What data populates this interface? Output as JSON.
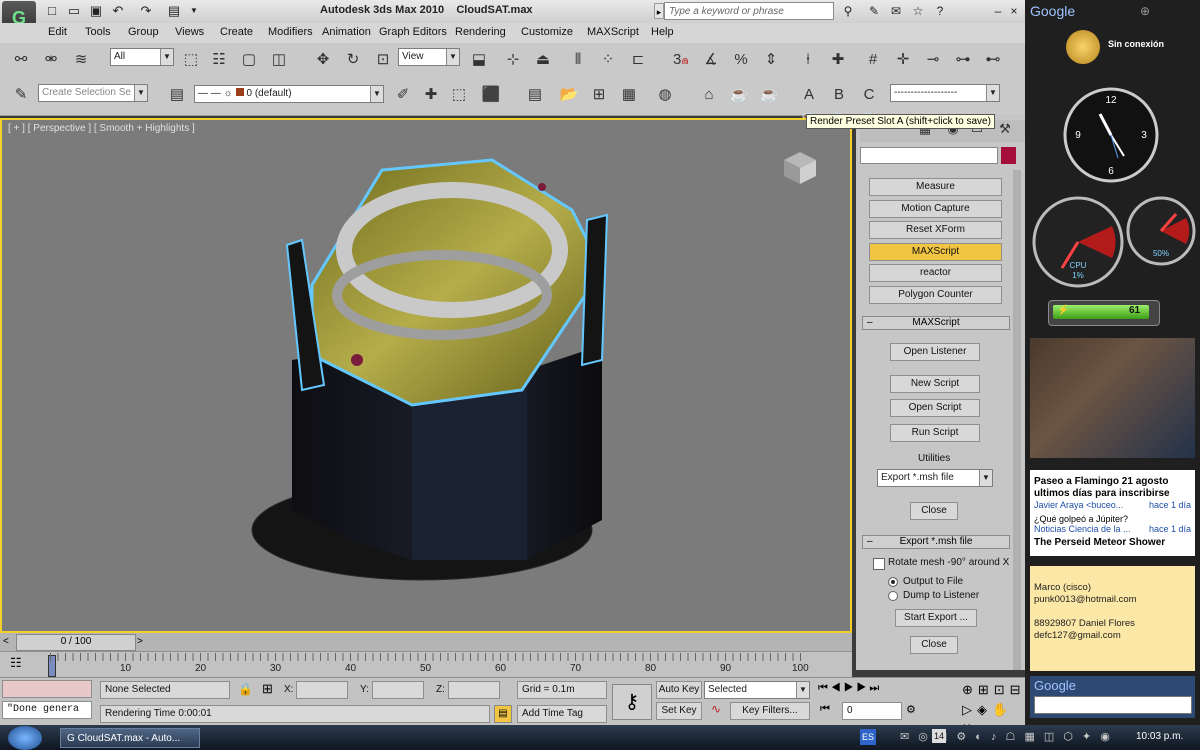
{
  "window": {
    "title": "Autodesk 3ds Max 2010",
    "file": "CloudSAT.max",
    "search_placeholder": "Type a keyword or phrase"
  },
  "menu": [
    "Edit",
    "Tools",
    "Group",
    "Views",
    "Create",
    "Modifiers",
    "Animation",
    "Graph Editors",
    "Rendering",
    "Customize",
    "MAXScript",
    "Help"
  ],
  "toolbar": {
    "selection_filter": "All",
    "view_combo": "View",
    "named_selection_placeholder": "Create Selection Se",
    "layer_name": "0 (default)",
    "preset_slots": [
      "A",
      "B",
      "C"
    ],
    "preset_combo": "-------------------"
  },
  "tooltip": "Render Preset Slot A (shift+click to save)",
  "viewport": {
    "label": "[ + ] [ Perspective ] [ Smooth + Highlights ]"
  },
  "utilities": {
    "buttons": [
      "Measure",
      "Motion Capture",
      "Reset XForm",
      "MAXScript",
      "reactor",
      "Polygon Counter"
    ],
    "active": "MAXScript"
  },
  "maxscript_rollout": {
    "title": "MAXScript",
    "open_listener": "Open Listener",
    "new_script": "New Script",
    "open_script": "Open Script",
    "run_script": "Run Script",
    "utilities_label": "Utilities",
    "utilities_selected": "Export *.msh file",
    "close": "Close"
  },
  "export_rollout": {
    "title": "Export *.msh file",
    "rotate_checkbox": "Rotate mesh -90° around X",
    "output_file": "Output to File",
    "dump_listener": "Dump to Listener",
    "start_export": "Start Export ...",
    "close": "Close"
  },
  "timeline": {
    "frame_counter": "0 / 100",
    "ticks": [
      "10",
      "20",
      "30",
      "40",
      "50",
      "60",
      "70",
      "80",
      "90",
      "100"
    ]
  },
  "status": {
    "script_line": "\"Done genera",
    "selection": "None Selected",
    "x_label": "X:",
    "y_label": "Y:",
    "z_label": "Z:",
    "grid": "Grid = 0.1m",
    "add_time_tag": "Add Time Tag",
    "rendering_time": "Rendering Time  0:00:01",
    "auto_key": "Auto Key",
    "set_key": "Set Key",
    "key_mode": "Selected",
    "key_filters": "Key Filters...",
    "frame_input": "0"
  },
  "sidebar": {
    "google": "Google",
    "weather": "Sin conexión",
    "battery": "61",
    "cpu_label": "CPU",
    "cpu_value": "1%",
    "mem_value": "50%",
    "feed": [
      {
        "title": "Paseo a Flamingo 21 agosto ultimos días para inscribirse",
        "source": "Javier Araya <buceo...",
        "time": "hace 1 día"
      },
      {
        "title": "¿Qué golpeó a Júpiter?",
        "source": "Noticias Ciencia de la ...",
        "time": "hace 1 día"
      },
      {
        "title": "The Perseid Meteor Shower",
        "source": "",
        "time": ""
      }
    ],
    "note_lines": [
      "Marco (cisco)",
      "punk0013@hotmail.com",
      "",
      "88929807 Daniel Flores",
      "defc127@gmail.com"
    ],
    "google_search": "Google"
  },
  "taskbar": {
    "task": "CloudSAT.max - Auto...",
    "lang": "ES",
    "clock": "10:03 p.m.",
    "tray_badge": "14"
  }
}
